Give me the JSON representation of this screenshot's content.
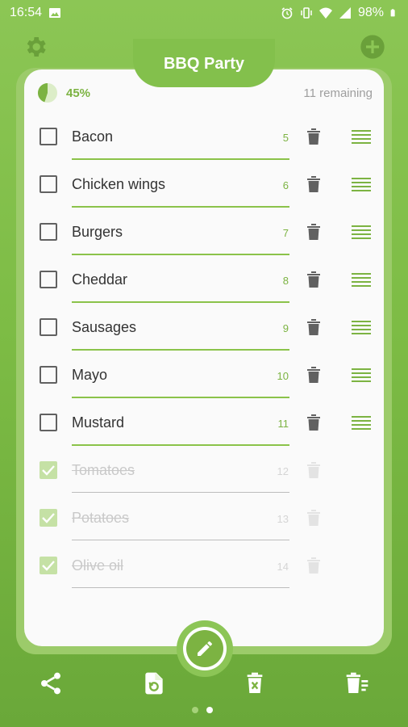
{
  "status_bar": {
    "time": "16:54",
    "battery": "98%"
  },
  "header": {
    "title": "BBQ Party"
  },
  "progress": {
    "percent_label": "45%",
    "percent": 0.45,
    "remaining": "11 remaining"
  },
  "items": [
    {
      "name": "Bacon",
      "qty": "5",
      "checked": false
    },
    {
      "name": "Chicken wings",
      "qty": "6",
      "checked": false
    },
    {
      "name": "Burgers",
      "qty": "7",
      "checked": false
    },
    {
      "name": "Cheddar",
      "qty": "8",
      "checked": false
    },
    {
      "name": "Sausages",
      "qty": "9",
      "checked": false
    },
    {
      "name": "Mayo",
      "qty": "10",
      "checked": false
    },
    {
      "name": "Mustard",
      "qty": "11",
      "checked": false
    },
    {
      "name": "Tomatoes",
      "qty": "12",
      "checked": true
    },
    {
      "name": "Potatoes",
      "qty": "13",
      "checked": true
    },
    {
      "name": "Olive oil",
      "qty": "14",
      "checked": true
    }
  ],
  "icons": {
    "settings": "gear-icon",
    "add": "add-circle-icon",
    "edit": "pencil-icon",
    "share": "share-icon",
    "restore": "restore-file-icon",
    "delete_list": "trash-x-icon",
    "clear_checked": "clear-list-icon"
  },
  "pager": {
    "pages": 2,
    "active": 1
  },
  "colors": {
    "accent": "#7cb342",
    "background": "#8cc655",
    "checked": "#c5e1a5"
  }
}
